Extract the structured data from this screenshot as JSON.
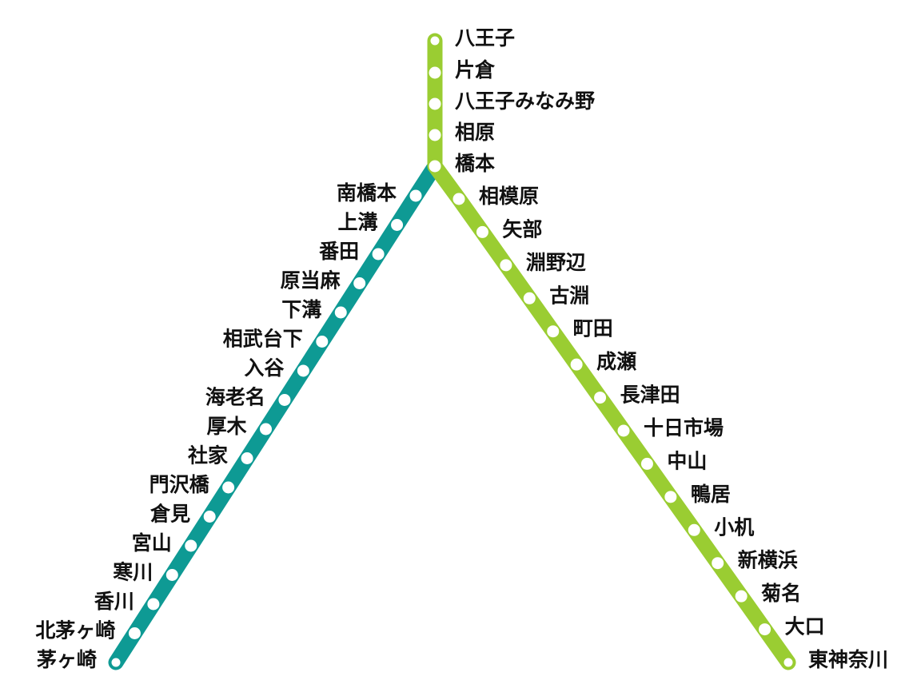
{
  "colors": {
    "yokohama_line": "#9ACD32",
    "sagami_line": "#0E9A94",
    "station_fill": "#ffffff",
    "text": "#111111"
  },
  "lines": {
    "yokohama_line": {
      "stations": [
        "八王子",
        "片倉",
        "八王子みなみ野",
        "相原",
        "橋本",
        "相模原",
        "矢部",
        "淵野辺",
        "古淵",
        "町田",
        "成瀬",
        "長津田",
        "十日市場",
        "中山",
        "鴨居",
        "小机",
        "新横浜",
        "菊名",
        "大口",
        "東神奈川"
      ]
    },
    "sagami_line": {
      "stations": [
        "南橋本",
        "上溝",
        "番田",
        "原当麻",
        "下溝",
        "相武台下",
        "入谷",
        "海老名",
        "厚木",
        "社家",
        "門沢橋",
        "倉見",
        "宮山",
        "寒川",
        "香川",
        "北茅ヶ崎",
        "茅ヶ崎"
      ]
    }
  }
}
